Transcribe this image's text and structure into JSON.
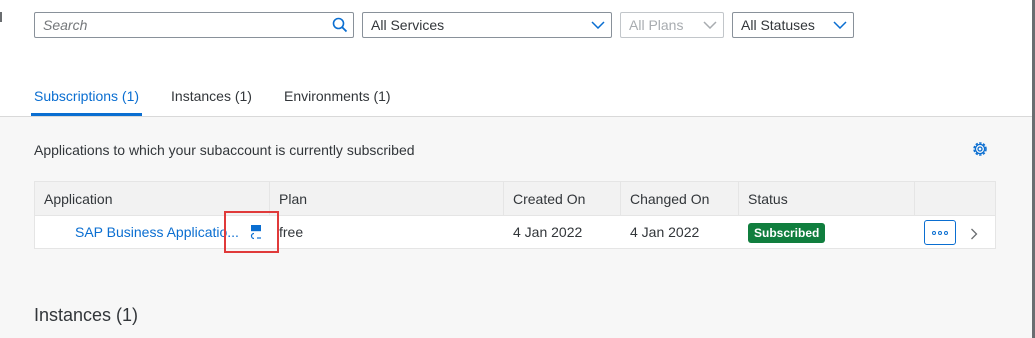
{
  "filters": {
    "search_placeholder": "Search",
    "services": "All Services",
    "plans": "All Plans",
    "statuses": "All Statuses"
  },
  "tabs": [
    {
      "label": "Subscriptions (1)",
      "active": true
    },
    {
      "label": "Instances (1)",
      "active": false
    },
    {
      "label": "Environments (1)",
      "active": false
    }
  ],
  "subscriptions": {
    "description": "Applications to which your subaccount is currently subscribed",
    "columns": [
      "Application",
      "Plan",
      "Created On",
      "Changed On",
      "Status"
    ],
    "rows": [
      {
        "application": "SAP Business Applicatio...",
        "plan": "free",
        "created_on": "4 Jan 2022",
        "changed_on": "4 Jan 2022",
        "status": "Subscribed"
      }
    ]
  },
  "instances_section": {
    "title": "Instances (1)"
  },
  "colors": {
    "accent": "#0a6ed1",
    "success": "#107e3e",
    "highlight": "#e03a3a"
  }
}
